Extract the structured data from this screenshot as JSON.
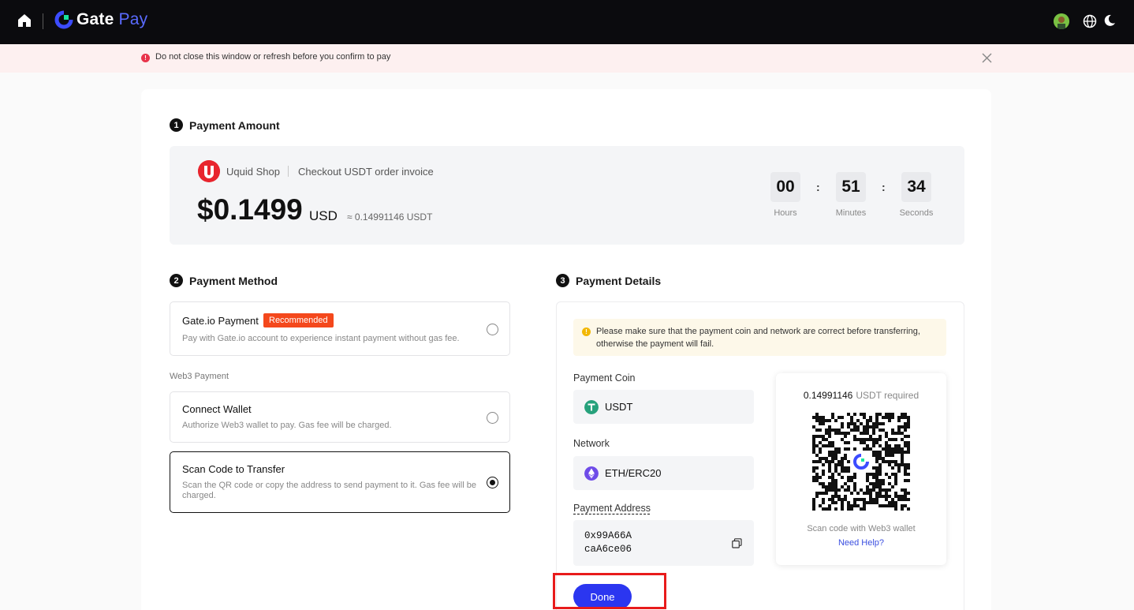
{
  "header": {
    "logo_gate": "Gate",
    "logo_pay": "Pay"
  },
  "banner": {
    "text": "Do not close this window or refresh before you confirm to pay"
  },
  "section1": {
    "number": "1",
    "title": "Payment Amount"
  },
  "amount": {
    "shop_name": "Uquid Shop",
    "description": "Checkout USDT order invoice",
    "value": "$0.1499",
    "currency": "USD",
    "usdt_equiv": "≈ 0.14991146 USDT"
  },
  "timer": {
    "hours": "00",
    "minutes": "51",
    "seconds": "34",
    "hours_label": "Hours",
    "minutes_label": "Minutes",
    "seconds_label": "Seconds",
    "colon": ":"
  },
  "section2": {
    "number": "2",
    "title": "Payment Method"
  },
  "methods": {
    "gateio": {
      "title": "Gate.io Payment",
      "badge": "Recommended",
      "desc": "Pay with Gate.io account to experience instant payment without gas fee."
    },
    "web3_label": "Web3 Payment",
    "wallet": {
      "title": "Connect Wallet",
      "desc": "Authorize Web3 wallet to pay. Gas fee will be charged."
    },
    "scan": {
      "title": "Scan Code to Transfer",
      "desc": "Scan the QR code or copy the address to send payment to it. Gas fee will be charged."
    }
  },
  "section3": {
    "number": "3",
    "title": "Payment Details"
  },
  "details": {
    "notice": "Please make sure that the payment coin and network are correct before transferring, otherwise the payment will fail.",
    "coin_label": "Payment Coin",
    "coin_value": "USDT",
    "network_label": "Network",
    "network_value": "ETH/ERC20",
    "address_label": "Payment Address",
    "address_line1": "0x99A66A",
    "address_line2": "caA6ce06"
  },
  "qr": {
    "amount": "0.14991146",
    "required": "USDT required",
    "hint": "Scan code with Web3 wallet",
    "help": "Need Help?"
  },
  "done_label": "Done",
  "colors": {
    "accent": "#2b36f0",
    "recommended": "#f4481c",
    "usdt": "#26a17b",
    "eth": "#6f4ce8",
    "highlight": "#e81b1b"
  },
  "icons": [
    "home-icon",
    "gate-logo-icon",
    "avatar",
    "globe-icon",
    "moon-icon",
    "alert-icon",
    "close-icon",
    "copy-icon",
    "usdt-icon",
    "eth-icon"
  ]
}
